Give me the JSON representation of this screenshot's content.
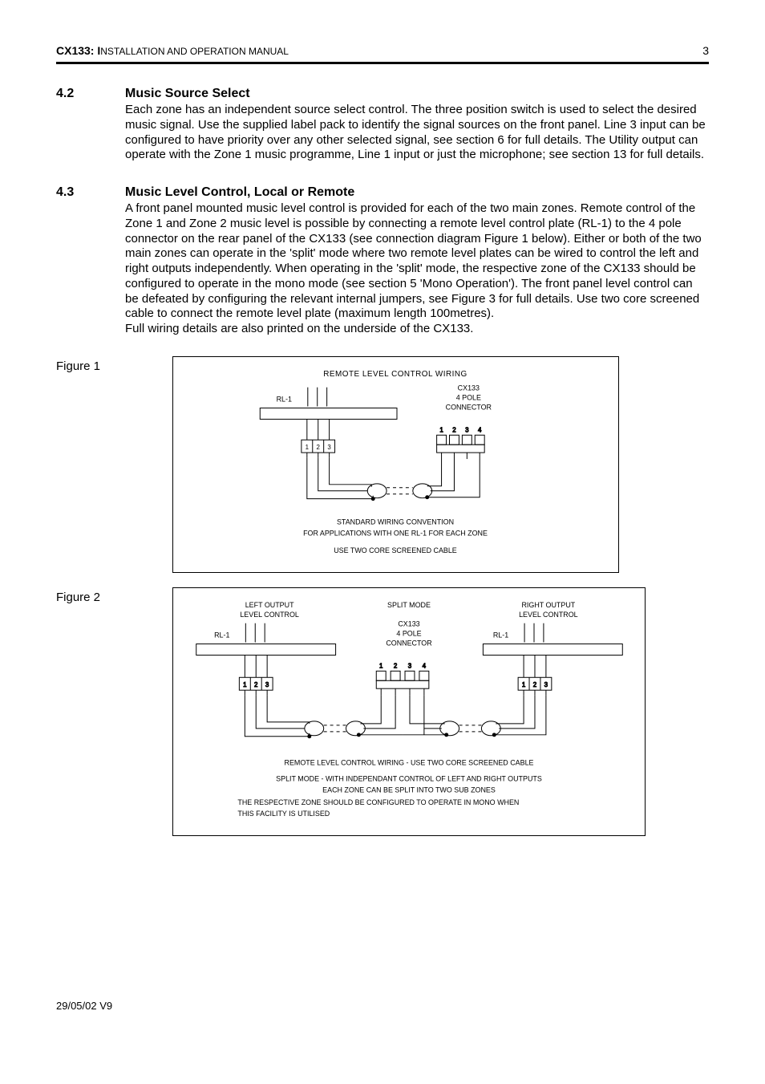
{
  "header": {
    "product_bold": "CX133:",
    "product_rest_caps": " I",
    "product_rest_small": "NSTALLATION AND OPERATION MANUAL",
    "page_number": "3"
  },
  "sections": {
    "s42": {
      "num": "4.2",
      "title": "Music Source Select",
      "text": "Each zone has an independent source select control. The three position switch is used to select the desired music signal. Use the supplied label pack to identify the signal sources on the front panel. Line 3 input can be configured to have priority over any other selected signal, see section 6 for full details. The Utility output can operate with the Zone 1 music programme, Line 1 input or just the microphone; see section 13 for full details."
    },
    "s43": {
      "num": "4.3",
      "title": "Music Level Control, Local or Remote",
      "text1": "A front panel mounted music level control is provided for each of the two main zones. Remote control of the Zone 1 and Zone 2 music level is possible by connecting a remote level control plate (RL-1) to the 4 pole connector on the rear panel of the CX133 (see connection diagram Figure 1 below). Either or both of the two main zones can operate in the 'split' mode where two remote level plates can be wired to control the left and right outputs independently. When operating in the 'split' mode, the respective zone of the CX133 should be configured to operate in the mono mode (see section 5 'Mono Operation'). The front panel level control can be defeated by configuring the relevant internal jumpers, see Figure 3 for full details. Use two core screened cable to connect the remote level plate (maximum length 100metres).",
      "text2": "Full wiring details are also printed on the underside of the CX133."
    }
  },
  "figures": {
    "f1": {
      "label": "Figure 1",
      "title": "REMOTE LEVEL CONTROL WIRING",
      "rl1": "RL-1",
      "conn1": "CX133",
      "conn2": "4 POLE",
      "conn3": "CONNECTOR",
      "pins_rl": [
        "1",
        "2",
        "3"
      ],
      "pins_conn": [
        "1",
        "2",
        "3",
        "4"
      ],
      "caption1": "STANDARD WIRING CONVENTION",
      "caption2": "FOR APPLICATIONS WITH ONE RL-1 FOR EACH ZONE",
      "caption3": "USE TWO CORE SCREENED CABLE"
    },
    "f2": {
      "label": "Figure 2",
      "left1": "LEFT OUTPUT",
      "left2": "LEVEL CONTROL",
      "mid": "SPLIT MODE",
      "right1": "RIGHT OUTPUT",
      "right2": "LEVEL CONTROL",
      "conn1": "CX133",
      "conn2": "4 POLE",
      "conn3": "CONNECTOR",
      "rl1": "RL-1",
      "pins_rl": [
        "1",
        "2",
        "3"
      ],
      "pins_conn": [
        "1",
        "2",
        "3",
        "4"
      ],
      "cap1": "REMOTE LEVEL CONTROL WIRING  -  USE TWO CORE SCREENED CABLE",
      "cap2": "SPLIT MODE  -  WITH INDEPENDANT CONTROL OF LEFT AND RIGHT OUTPUTS",
      "cap3": "EACH ZONE CAN BE SPLIT INTO TWO SUB ZONES",
      "cap4": "THE RESPECTIVE ZONE SHOULD BE CONFIGURED TO OPERATE IN MONO WHEN",
      "cap5": "THIS FACILITY IS UTILISED"
    }
  },
  "footer": {
    "text": "29/05/02 V9"
  }
}
